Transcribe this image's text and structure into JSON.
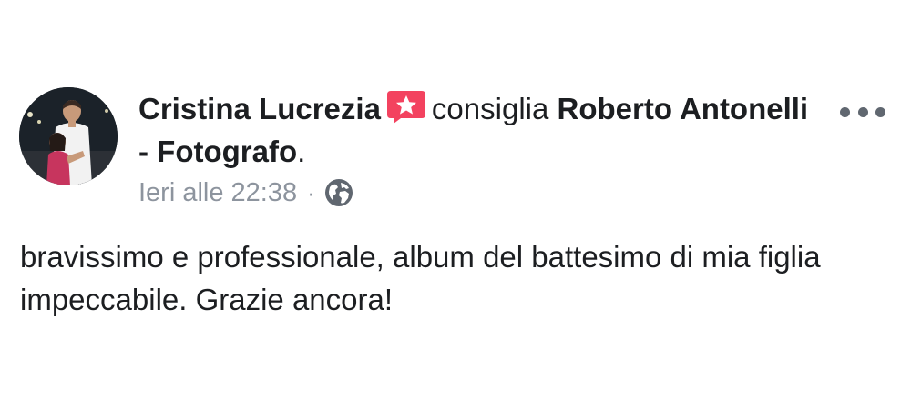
{
  "post": {
    "author_name": "Cristina Lucrezia",
    "verb": "consiglia",
    "page_name": "Roberto Antonelli - Fotografo",
    "page_suffix": ".",
    "timestamp": "Ieri alle 22:38",
    "separator": "·",
    "privacy_icon": "globe-icon",
    "recommend_icon": "recommend-star-icon",
    "more_icon": "more-options-icon",
    "message": "bravissimo e professionale, album del battesimo di mia figlia impeccabile. Grazie ancora!"
  },
  "colors": {
    "recommend_badge": "#f3425f",
    "meta_text": "#8d949e",
    "primary_text": "#1c1e21"
  }
}
